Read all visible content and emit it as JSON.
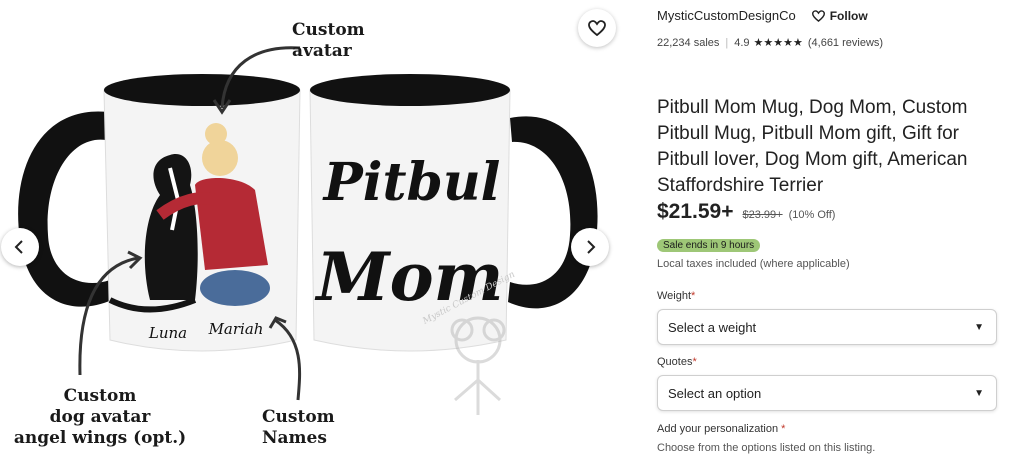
{
  "gallery": {
    "annotations": {
      "custom_avatar": "Custom\navatar",
      "custom_dog": "Custom\ndog avatar\nangel wings (opt.)",
      "custom_names": "Custom\nNames"
    },
    "mug_text_line1": "Pitbul",
    "mug_text_line2": "Mom",
    "name_dog": "Luna",
    "name_owner": "Mariah",
    "watermark": "Mystic Custom Design",
    "prev_icon": "chevron-left-icon",
    "next_icon": "chevron-right-icon",
    "favorite_icon": "heart-icon"
  },
  "shop": {
    "name": "MysticCustomDesignCo",
    "follow_label": "Follow",
    "sales": "22,234 sales",
    "rating": "4.9",
    "stars": "★★★★★",
    "reviews": "(4,661 reviews)"
  },
  "listing": {
    "title": "Pitbull Mom Mug, Dog Mom, Custom Pitbull Mug, Pitbull Mom gift, Gift for Pitbull lover, Dog Mom gift, American Staffordshire Terrier",
    "price": "$21.59+",
    "old_price": "$23.99+",
    "discount": "(10% Off)",
    "sale_badge": "Sale ends in 9 hours",
    "taxes": "Local taxes included (where applicable)"
  },
  "options": {
    "weight_label": "Weight",
    "weight_value": "Select a weight",
    "quotes_label": "Quotes",
    "quotes_value": "Select an option",
    "required_mark": "*",
    "personalization_label": "Add your personalization",
    "personalization_hint": "Choose from the options listed on this listing."
  },
  "colors": {
    "sale_badge": "#9ec777",
    "required": "#c0392b"
  }
}
